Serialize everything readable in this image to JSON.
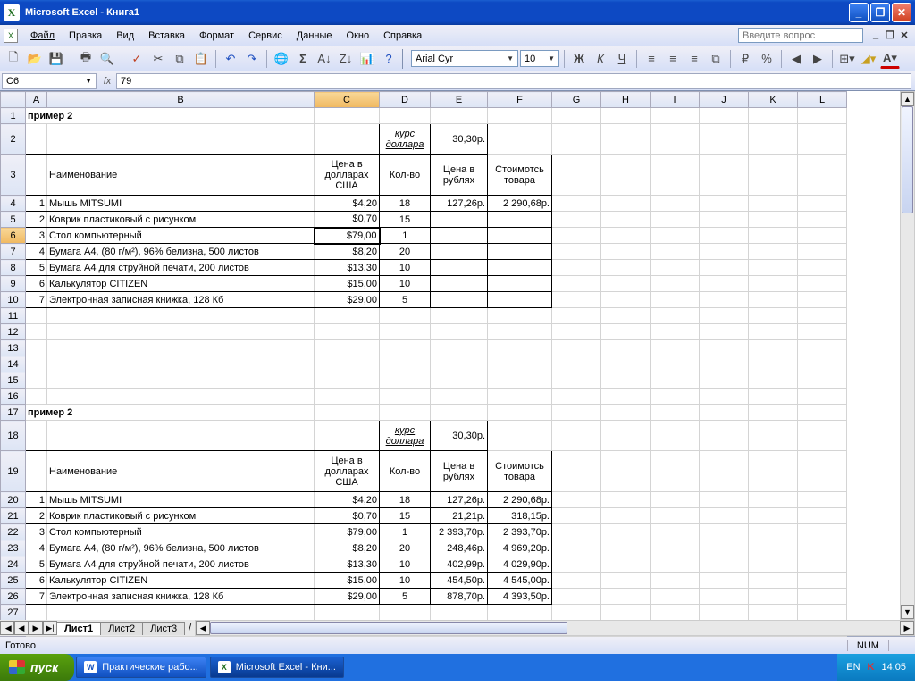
{
  "titlebar": {
    "app": "Microsoft Excel",
    "doc": "Книга1"
  },
  "menu": {
    "file": "Файл",
    "edit": "Правка",
    "view": "Вид",
    "insert": "Вставка",
    "format": "Формат",
    "service": "Сервис",
    "data": "Данные",
    "window": "Окно",
    "help": "Справка",
    "question": "Введите вопрос"
  },
  "toolbar": {
    "font": "Arial Cyr",
    "size": "10"
  },
  "formula": {
    "namebox": "C6",
    "value": "79"
  },
  "columns": [
    "A",
    "B",
    "C",
    "D",
    "E",
    "F",
    "G",
    "H",
    "I",
    "J",
    "K",
    "L"
  ],
  "labels": {
    "title": "пример 2",
    "rate_lbl": "курс доллара",
    "rate_val": "30,30р.",
    "h_name": "Наименование",
    "h_price": "Цена в долларах США",
    "h_qty": "Кол-во",
    "h_rub": "Цена в рублях",
    "h_cost": "Стоимотсь товара"
  },
  "rows1": [
    {
      "n": "1",
      "name": "Мышь MITSUMI",
      "price": "$4,20",
      "qty": "18",
      "rub": "127,26р.",
      "cost": "2 290,68р."
    },
    {
      "n": "2",
      "name": "Коврик пластиковый с рисунком",
      "price": "$0,70",
      "qty": "15",
      "rub": "",
      "cost": ""
    },
    {
      "n": "3",
      "name": "Стол компьютерный",
      "price": "$79,00",
      "qty": "1",
      "rub": "",
      "cost": ""
    },
    {
      "n": "4",
      "name": "Бумага А4, (80 г/м²), 96% белизна, 500 листов",
      "price": "$8,20",
      "qty": "20",
      "rub": "",
      "cost": ""
    },
    {
      "n": "5",
      "name": "Бумага А4 для струйной печати, 200 листов",
      "price": "$13,30",
      "qty": "10",
      "rub": "",
      "cost": ""
    },
    {
      "n": "6",
      "name": "Калькулятор CITIZEN",
      "price": "$15,00",
      "qty": "10",
      "rub": "",
      "cost": ""
    },
    {
      "n": "7",
      "name": "Электронная записная книжка, 128 Кб",
      "price": "$29,00",
      "qty": "5",
      "rub": "",
      "cost": ""
    }
  ],
  "rows2": [
    {
      "n": "1",
      "name": "Мышь MITSUMI",
      "price": "$4,20",
      "qty": "18",
      "rub": "127,26р.",
      "cost": "2 290,68р."
    },
    {
      "n": "2",
      "name": "Коврик пластиковый с рисунком",
      "price": "$0,70",
      "qty": "15",
      "rub": "21,21р.",
      "cost": "318,15р."
    },
    {
      "n": "3",
      "name": "Стол компьютерный",
      "price": "$79,00",
      "qty": "1",
      "rub": "2 393,70р.",
      "cost": "2 393,70р."
    },
    {
      "n": "4",
      "name": "Бумага А4, (80 г/м²), 96% белизна, 500 листов",
      "price": "$8,20",
      "qty": "20",
      "rub": "248,46р.",
      "cost": "4 969,20р."
    },
    {
      "n": "5",
      "name": "Бумага А4 для струйной печати, 200 листов",
      "price": "$13,30",
      "qty": "10",
      "rub": "402,99р.",
      "cost": "4 029,90р."
    },
    {
      "n": "6",
      "name": "Калькулятор CITIZEN",
      "price": "$15,00",
      "qty": "10",
      "rub": "454,50р.",
      "cost": "4 545,00р."
    },
    {
      "n": "7",
      "name": "Электронная записная книжка, 128 Кб",
      "price": "$29,00",
      "qty": "5",
      "rub": "878,70р.",
      "cost": "4 393,50р."
    }
  ],
  "sheets": [
    "Лист1",
    "Лист2",
    "Лист3"
  ],
  "status": {
    "ready": "Готово",
    "num": "NUM"
  },
  "taskbar": {
    "start": "пуск",
    "task1": "Практические рабо...",
    "task2": "Microsoft Excel - Кни...",
    "lang": "EN",
    "time": "14:05"
  }
}
